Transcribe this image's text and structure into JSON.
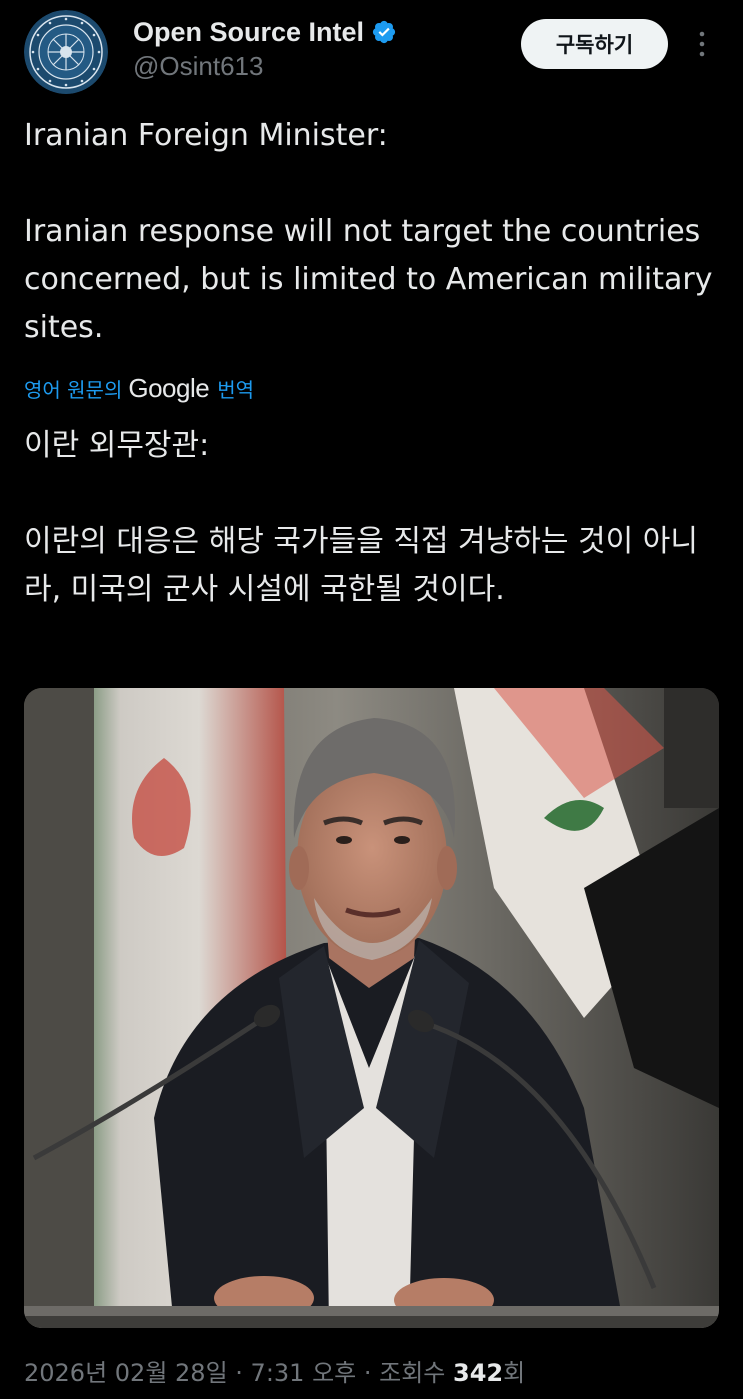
{
  "account": {
    "display_name": "Open Source Intel",
    "handle": "@Osint613",
    "verified": true
  },
  "subscribe_label": "구독하기",
  "tweet": {
    "original_text": "Iranian Foreign Minister:\n\nIranian response will not target the countries concerned, but is limited to American military sites.",
    "translation_prefix": "영어 원문의",
    "translation_brand": "Google",
    "translation_suffix": "번역",
    "translated_text": "이란 외무장관:\n\n이란의 대응은 해당 국가들을 직접 겨냥하는 것이 아니라, 미국의 군사 시설에 국한될 것이다."
  },
  "meta": {
    "date": "2026년 02월 28일",
    "separator": " · ",
    "time": "7:31 오후",
    "views_label": "조회수",
    "views_count": "342",
    "views_suffix": "회"
  },
  "icons": {
    "avatar": "emblem-avatar",
    "verified": "verified-badge-icon",
    "more": "more-vertical-icon"
  },
  "colors": {
    "background": "#000000",
    "text": "#e7e9ea",
    "muted": "#71767b",
    "accent": "#1d9bf0",
    "button_bg": "#eff3f4"
  }
}
